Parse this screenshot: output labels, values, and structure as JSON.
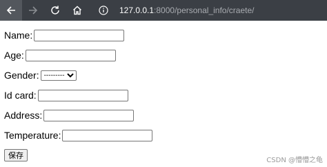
{
  "browser": {
    "url_host": "127.0.0.1",
    "url_path": ":8000/personal_info/craete/",
    "icons": [
      "back-arrow-icon",
      "forward-arrow-icon",
      "refresh-icon",
      "home-icon",
      "info-icon"
    ]
  },
  "form": {
    "name_label": "Name:",
    "name_value": "",
    "age_label": "Age:",
    "age_value": "",
    "gender_label": "Gender:",
    "gender_selected": "---------",
    "idcard_label": "Id card:",
    "idcard_value": "",
    "address_label": "Address:",
    "address_value": "",
    "temperature_label": "Temperature:",
    "temperature_value": "",
    "save_label": "保存"
  },
  "watermark": "CSDN @懵懵之龟"
}
